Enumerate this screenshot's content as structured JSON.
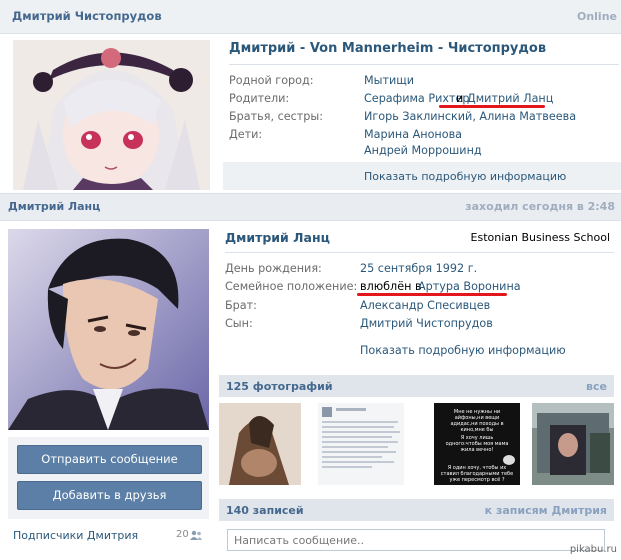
{
  "profile1": {
    "header_name": "Дмитрий Чистопрудов",
    "status": "Online",
    "title": "Дмитрий - Von Mannerheim - Чистопрудов",
    "rows": [
      {
        "label": "Родной город:",
        "value": "Мытищи"
      },
      {
        "label": "Родители:",
        "value_a": "Серафима Рихтер",
        "join": "и",
        "value_b": "Дмитрий Ланц"
      },
      {
        "label": "Братья, сестры:",
        "value": "Игорь Заклинский, Алина Матвеева"
      },
      {
        "label": "Дети:",
        "value": "Марина Анонова",
        "value2": "Андрей Моррошинд"
      }
    ],
    "more_info": "Показать подробную информацию"
  },
  "profile2": {
    "header_name": "Дмитрий Ланц",
    "status": "заходил сегодня в 2:48",
    "title": "Дмитрий Ланц",
    "company": "Estonian Business School",
    "rows": [
      {
        "label": "День рождения:",
        "value": "25 сентября 1992 г."
      },
      {
        "label": "Семейное положение:",
        "value_a": "влюблён в",
        "value_b": "Артура Воронина"
      },
      {
        "label": "Брат:",
        "value": "Александр Спесивцев"
      },
      {
        "label": "Сын:",
        "value": "Дмитрий Чистопрудов"
      }
    ],
    "more_info": "Показать подробную информацию",
    "buttons": {
      "message": "Отправить сообщение",
      "add_friend": "Добавить в друзья"
    },
    "subscribers": {
      "label": "Подписчики Дмитрия",
      "count": "20"
    },
    "photos": {
      "title": "125 фотографий",
      "all": "все"
    },
    "posts": {
      "title": "140 записей",
      "link": "к записям Дмитрия",
      "placeholder": "Написать сообщение.."
    },
    "thumb_texts": {
      "t3a": "Мне не нужны ни айфоны,ни вещи адидас,ни походы в кино,мне бы",
      "t3b": "Я хочу лишь одного:чтобы моя мама жила вечно!",
      "t3c": "Я один хочу, чтобы их ставил благодарными тебе уже пересмотр всё ?"
    }
  },
  "watermark": "pikabu.ru",
  "colors": {
    "link": "#2b587a",
    "button": "#5b7fa6",
    "header_bg": "#eef1f4",
    "annotation": "#e3171b"
  }
}
